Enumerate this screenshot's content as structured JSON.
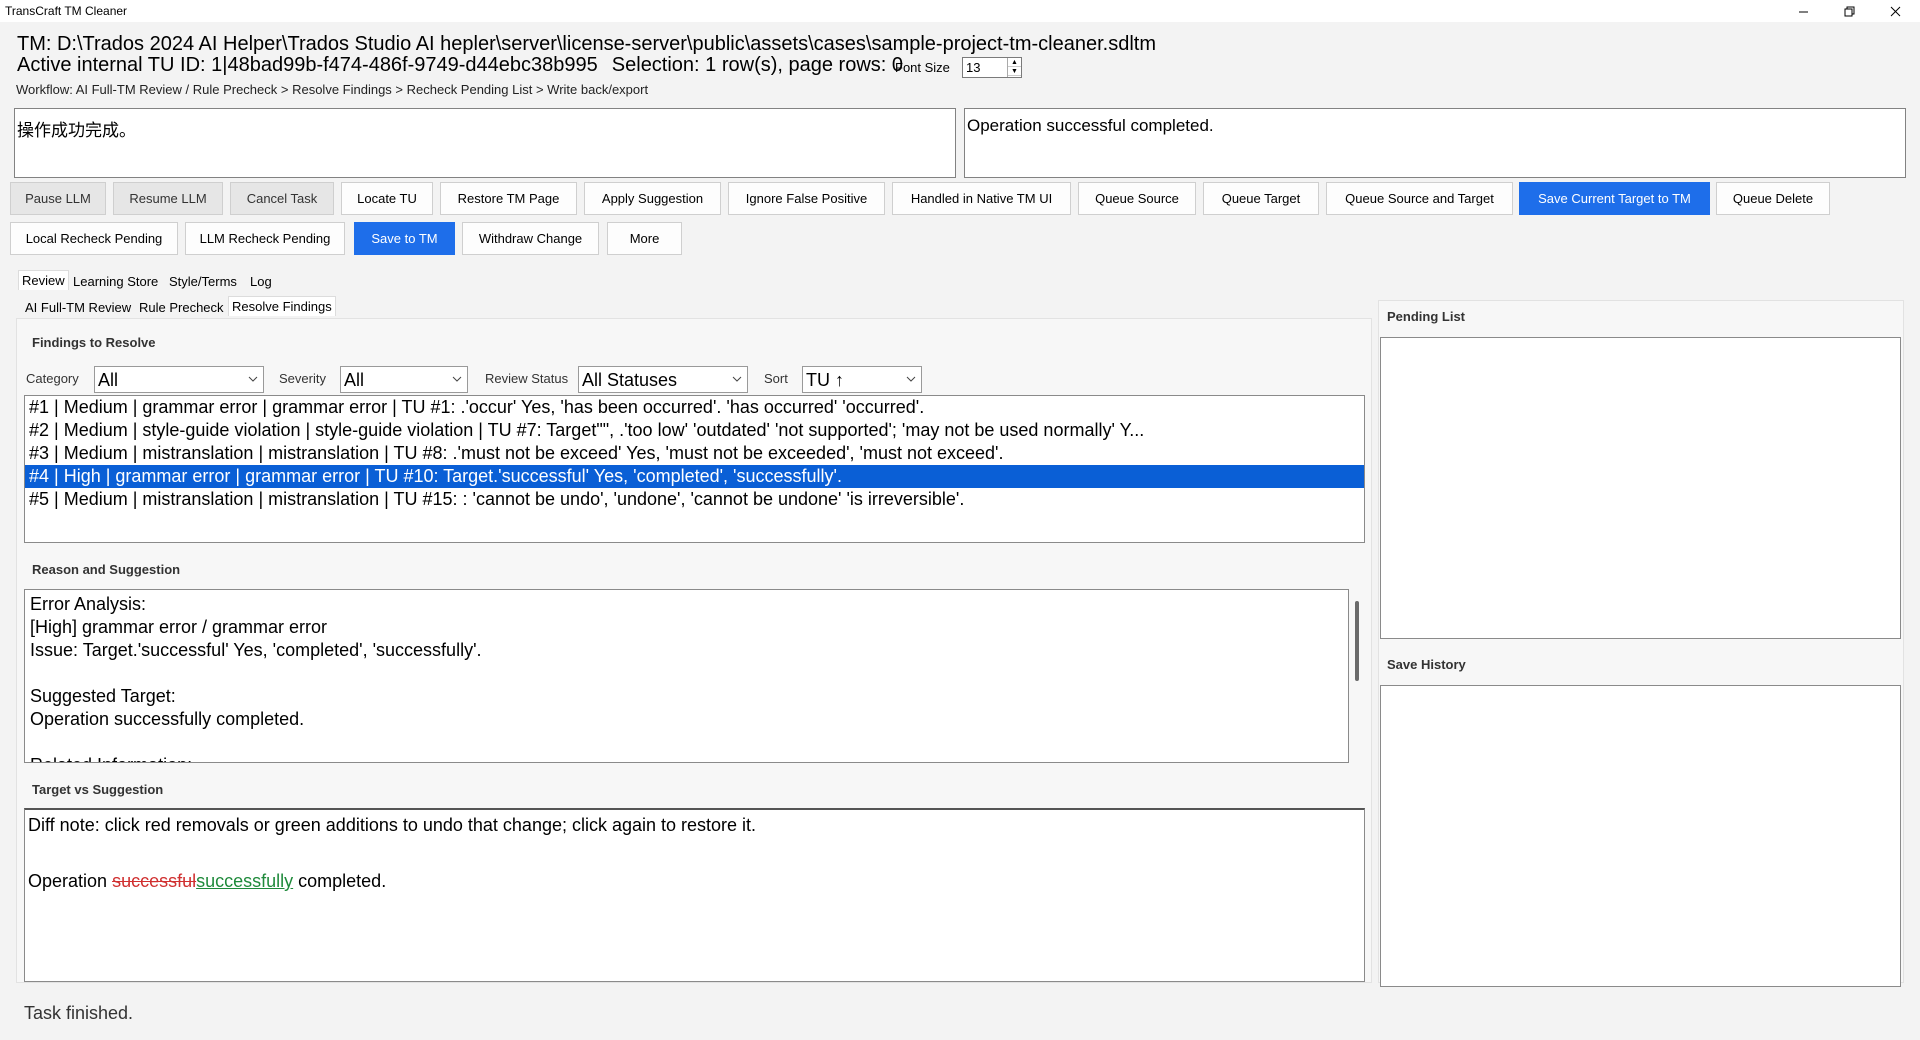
{
  "window": {
    "title": "TransCraft TM Cleaner",
    "minimize": "—",
    "restore": "❐",
    "close": "✕"
  },
  "info": {
    "tm_path": "TM: D:\\Trados 2024 AI Helper\\Trados Studio AI hepler\\server\\license-server\\public\\assets\\cases\\sample-project-tm-cleaner.sdltm",
    "active_tu": "Active internal TU ID: 1|48bad99b-f474-486f-9749-d44ebc38b995",
    "selection": "Selection: 1 row(s), page rows: 0",
    "font_size_label": "Font Size",
    "font_size_value": "13",
    "workflow": "Workflow: AI Full-TM Review / Rule Precheck > Resolve Findings > Recheck Pending List > Write back/export"
  },
  "source_text": "操作成功完成。",
  "target_text": "Operation successful completed.",
  "toolbar": {
    "row1": [
      "Pause LLM",
      "Resume LLM",
      "Cancel Task",
      "Locate TU",
      "Restore TM Page",
      "Apply Suggestion",
      "Ignore False Positive",
      "Handled in Native TM UI",
      "Queue Source",
      "Queue Target",
      "Queue Source and Target",
      "Save Current Target to TM",
      "Queue Delete"
    ],
    "row2": [
      "Local Recheck Pending",
      "LLM Recheck Pending",
      "Save to TM",
      "Withdraw Change",
      "More"
    ]
  },
  "tabs": [
    "Review",
    "Learning Store",
    "Style/Terms",
    "Log"
  ],
  "subtabs": [
    "AI Full-TM Review",
    "Rule Precheck",
    "Resolve Findings"
  ],
  "findings": {
    "title": "Findings to Resolve",
    "filters": {
      "category_label": "Category",
      "category_value": "All",
      "severity_label": "Severity",
      "severity_value": "All",
      "status_label": "Review Status",
      "status_value": "All Statuses",
      "sort_label": "Sort",
      "sort_value": "TU ↑"
    },
    "rows": [
      "#1 | Medium | grammar error | grammar error | TU #1: .'occur' Yes, 'has been occurred'. 'has occurred' 'occurred'.",
      "#2 | Medium | style-guide violation | style-guide violation | TU #7: Target\"\", .'too low' 'outdated' 'not supported'; 'may not be used normally' Y...",
      "#3 | Medium | mistranslation | mistranslation | TU #8: .'must not be exceed' Yes, 'must not be exceeded', 'must not exceed'.",
      "#4 | High | grammar error | grammar error | TU #10: Target.'successful' Yes, 'completed', 'successfully'.",
      "#5 | Medium | mistranslation | mistranslation | TU #15: : 'cannot be undo', 'undone', 'cannot be undone' 'is irreversible'."
    ]
  },
  "reason": {
    "title": "Reason and Suggestion",
    "lines": [
      "Error Analysis:",
      "[High] grammar error / grammar error",
      "Issue: Target.'successful' Yes, 'completed', 'successfully'.",
      "",
      "Suggested Target:",
      "Operation successfully completed.",
      "",
      "Related Information:"
    ]
  },
  "diff": {
    "title": "Target vs Suggestion",
    "note": "Diff note: click red removals or green additions to undo that change; click again to restore it.",
    "prefix": "Operation ",
    "removed": "successful",
    "added": "successfully",
    "suffix": " completed."
  },
  "side": {
    "pending_title": "Pending List",
    "history_title": "Save History"
  },
  "status": "Task finished."
}
